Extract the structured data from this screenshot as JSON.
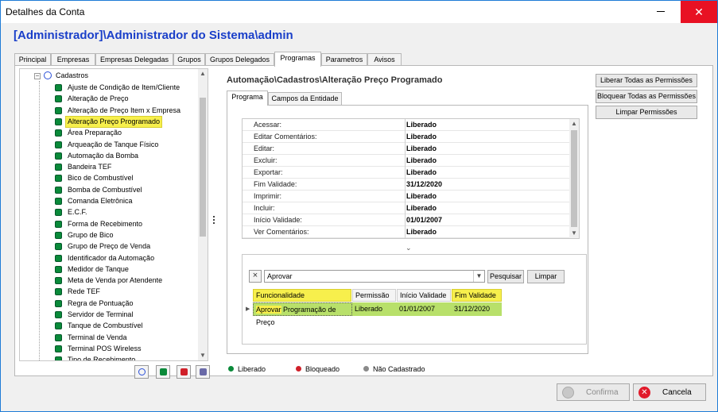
{
  "window": {
    "title": "Detalhes da Conta",
    "close_glyph": "✕"
  },
  "account_title": "[Administrador]\\Administrador do Sistema\\admin",
  "tabs": [
    {
      "label": "Principal"
    },
    {
      "label": "Empresas"
    },
    {
      "label": "Empresas Delegadas"
    },
    {
      "label": "Grupos"
    },
    {
      "label": "Grupos Delegados"
    },
    {
      "label": "Programas"
    },
    {
      "label": "Parametros"
    },
    {
      "label": "Avisos"
    }
  ],
  "tree": {
    "root_label": "Cadastros",
    "items": [
      "Ajuste de Condição de Item/Cliente",
      "Alteração de Preço",
      "Alteração de Preço Item x Empresa",
      "Alteração Preço Programado",
      "Área Preparação",
      "Arqueação de Tanque Físico",
      "Automação da Bomba",
      "Bandeira TEF",
      "Bico de Combustível",
      "Bomba de Combustível",
      "Comanda Eletrônica",
      "E.C.F.",
      "Forma de Recebimento",
      "Grupo de Bico",
      "Grupo de Preço de Venda",
      "Identificador da Automação",
      "Medidor de Tanque",
      "Meta de Venda por Atendente",
      "Rede TEF",
      "Regra de Pontuação",
      "Servidor de Terminal",
      "Tanque de Combustível",
      "Terminal de Venda",
      "Terminal POS Wireless",
      "Tipo de Recebimento"
    ],
    "selected_index": 3
  },
  "program": {
    "title": "Automação\\Cadastros\\Alteração Preço Programado",
    "subtabs": [
      {
        "label": "Programa"
      },
      {
        "label": "Campos da Entidade"
      }
    ],
    "permissions": [
      {
        "key": "Acessar:",
        "value": "Liberado"
      },
      {
        "key": "Editar Comentários:",
        "value": "Liberado"
      },
      {
        "key": "Editar:",
        "value": "Liberado"
      },
      {
        "key": "Excluir:",
        "value": "Liberado"
      },
      {
        "key": "Exportar:",
        "value": "Liberado"
      },
      {
        "key": "Fim Validade:",
        "value": "31/12/2020"
      },
      {
        "key": "Imprimir:",
        "value": "Liberado"
      },
      {
        "key": "Incluir:",
        "value": "Liberado"
      },
      {
        "key": "Início Validade:",
        "value": "01/01/2007"
      },
      {
        "key": "Ver Comentários:",
        "value": "Liberado"
      }
    ],
    "search": {
      "value": "Aprovar",
      "search_btn": "Pesquisar",
      "clear_btn": "Limpar"
    },
    "result": {
      "headers": [
        "Funcionalidade",
        "Permissão",
        "Início Validade",
        "Fim Validade"
      ],
      "row": {
        "func_match": "Aprovar",
        "func_rest": " Programação de Preço",
        "perm": "Liberado",
        "start": "01/01/2007",
        "end": "31/12/2020"
      }
    }
  },
  "right_buttons": [
    "Liberar Todas as Permissões",
    "Bloquear Todas as Permissões",
    "Limpar Permissões"
  ],
  "legend": [
    {
      "label": "Liberado",
      "color": "#0a8a3a"
    },
    {
      "label": "Bloqueado",
      "color": "#d0202a"
    },
    {
      "label": "Não Cadastrado",
      "color": "#8a8a8a"
    }
  ],
  "footer": {
    "confirm": "Confirma",
    "cancel": "Cancela"
  },
  "colors": {
    "accent": "#1a3fc9",
    "highlight": "#f7ef4c",
    "row_green": "#b8e06a",
    "close_red": "#e81123"
  }
}
